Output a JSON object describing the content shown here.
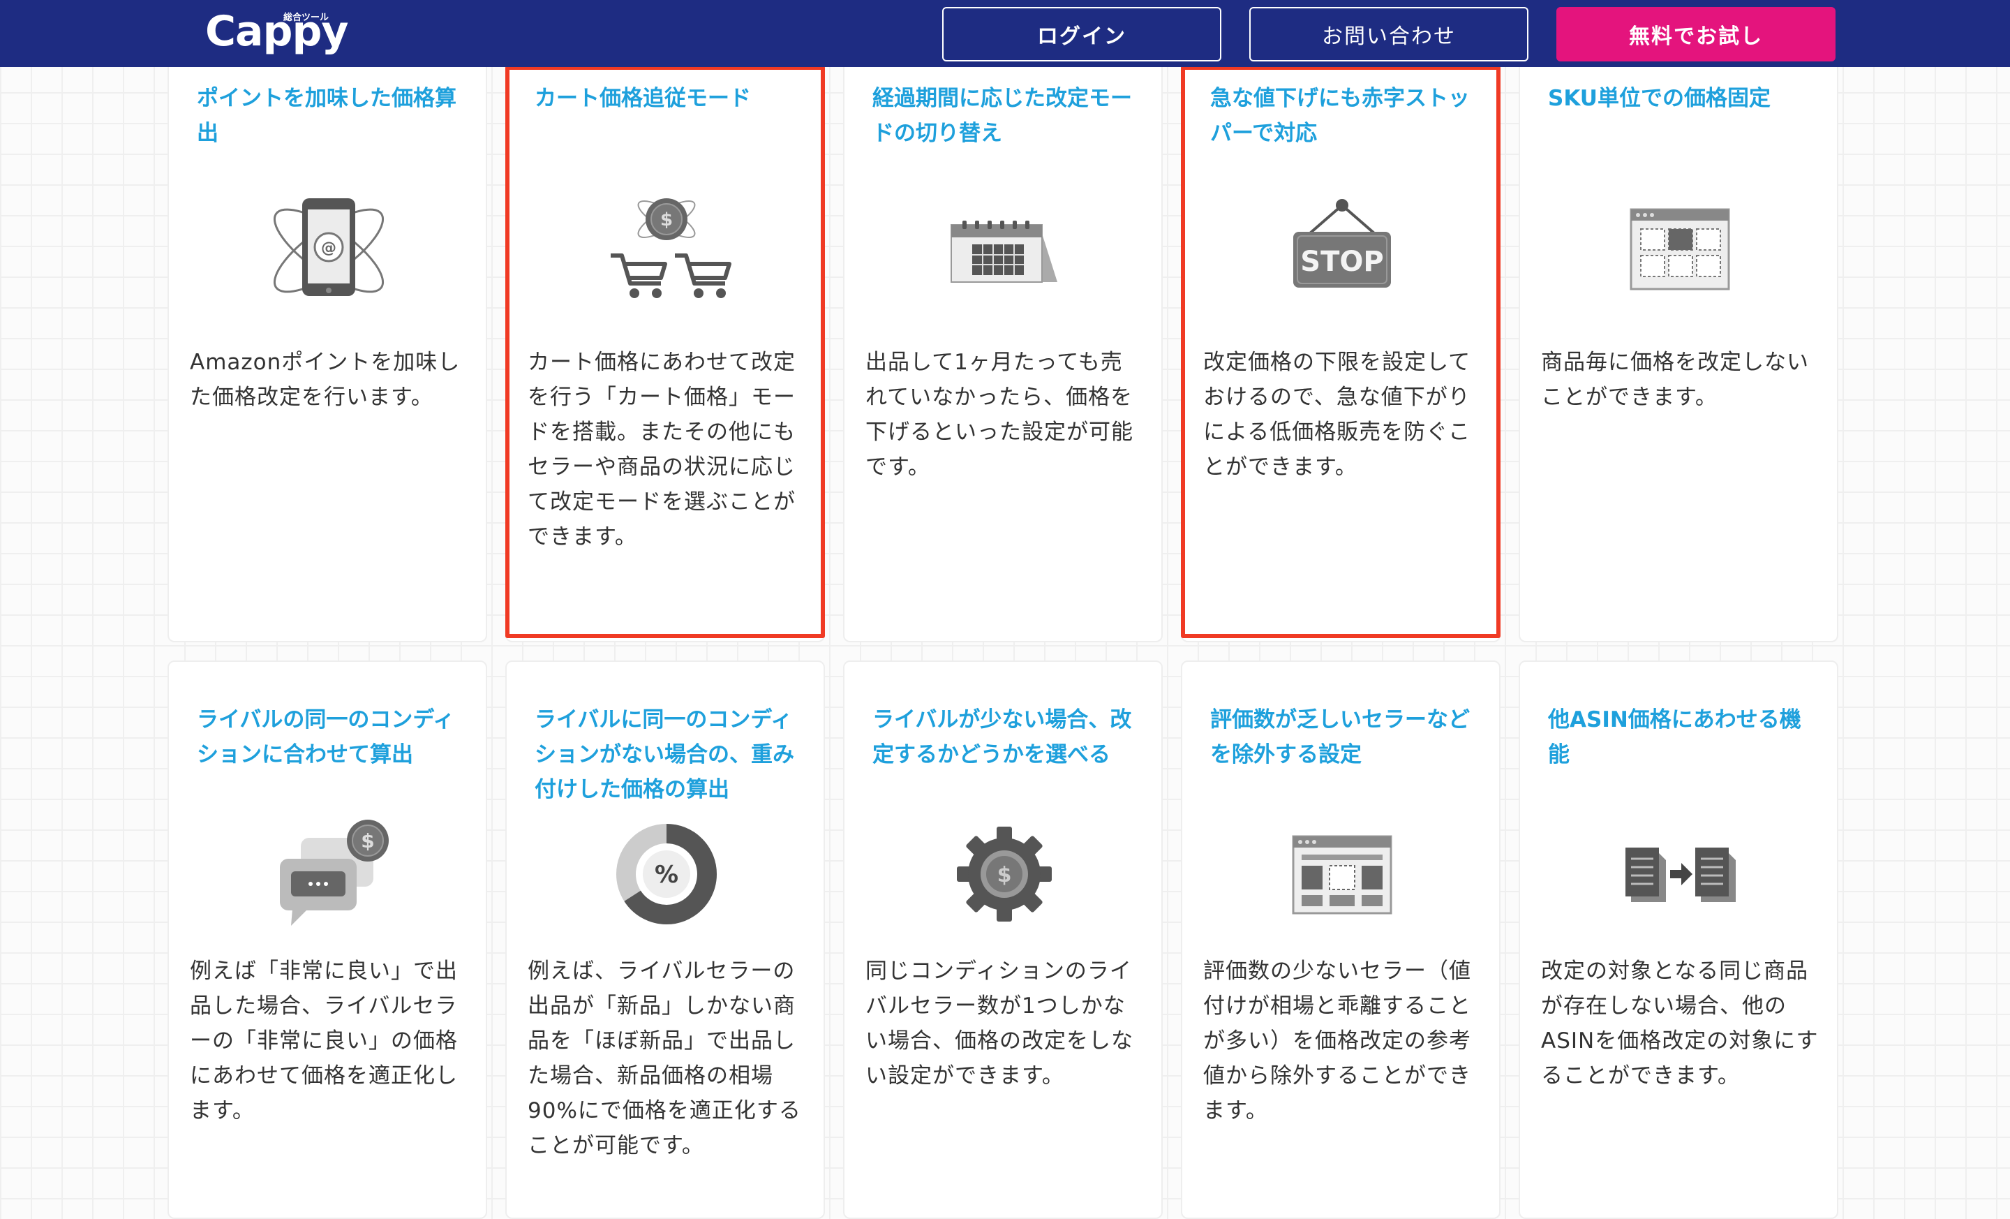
{
  "header": {
    "logo_text": "Cappy",
    "logo_tagline": "総合ツール",
    "login_label": "ログイン",
    "contact_label": "お問い合わせ",
    "trial_label": "無料でお試し"
  },
  "colors": {
    "header_bg": "#1e2c82",
    "trial_button": "#e4147d",
    "title_text": "#1ea0dc",
    "highlight_border": "#f03a24"
  },
  "features": [
    {
      "title": "ポイントを加味した価格算出",
      "icon": "smartphone-email-icon",
      "description": "Amazonポイントを加味した価格改定を行います。",
      "highlighted": false
    },
    {
      "title": "カート価格追従モード",
      "icon": "shopping-cart-dollar-icon",
      "description": "カート価格にあわせて改定を行う「カート価格」モードを搭載。またその他にもセラーや商品の状況に応じて改定モードを選ぶことができます。",
      "highlighted": true
    },
    {
      "title": "経過期間に応じた改定モードの切り替え",
      "icon": "calendar-icon",
      "description": "出品して1ヶ月たっても売れていなかったら、価格を下げるといった設定が可能です。",
      "highlighted": false
    },
    {
      "title": "急な値下げにも赤字ストッパーで対応",
      "icon": "stop-sign-icon",
      "description": "改定価格の下限を設定しておけるので、急な値下がりによる低価格販売を防ぐことができます。",
      "highlighted": true
    },
    {
      "title": "SKU単位での価格固定",
      "icon": "browser-grid-icon",
      "description": "商品毎に価格を改定しないことができます。",
      "highlighted": false
    },
    {
      "title": "ライバルの同一のコンディションに合わせて算出",
      "icon": "chat-dollar-icon",
      "description": "例えば「非常に良い」で出品した場合、ライバルセラーの「非常に良い」の価格にあわせて価格を適正化します。",
      "highlighted": false
    },
    {
      "title": "ライバルに同一のコンディションがない場合の、重み付けした価格の算出",
      "icon": "percent-donut-icon",
      "description": "例えば、ライバルセラーの出品が「新品」しかない商品を「ほぼ新品」で出品した場合、新品価格の相場90%にで価格を適正化することが可能です。",
      "highlighted": false
    },
    {
      "title": "ライバルが少ない場合、改定するかどうかを選べる",
      "icon": "gear-dollar-icon",
      "description": "同じコンディションのライバルセラー数が1つしかない場合、価格の改定をしない設定ができます。",
      "highlighted": false
    },
    {
      "title": "評価数が乏しいセラーなどを除外する設定",
      "icon": "browser-layout-icon",
      "description": "評価数の少ないセラー（値付けが相場と乖離することが多い）を価格改定の参考値から除外することができます。",
      "highlighted": false
    },
    {
      "title": "他ASIN価格にあわせる機能",
      "icon": "document-transfer-icon",
      "description": "改定の対象となる同じ商品が存在しない場合、他のASINを価格改定の対象にすることができます。",
      "highlighted": false
    }
  ]
}
